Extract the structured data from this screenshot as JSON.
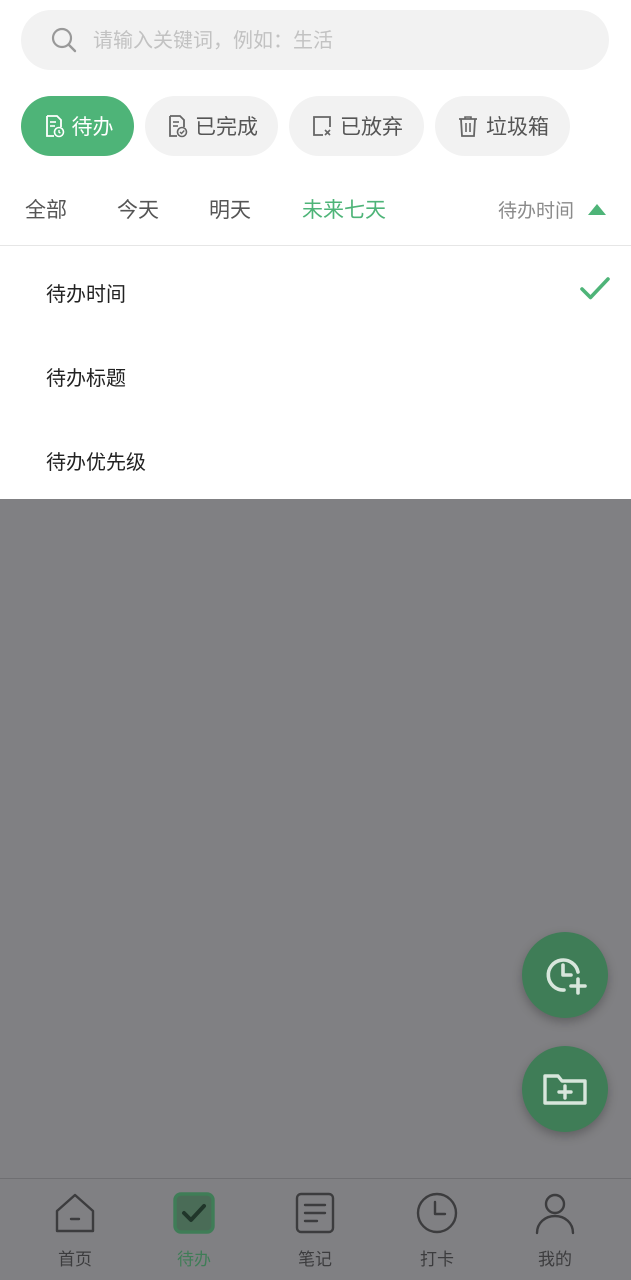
{
  "search": {
    "placeholder": "请输入关键词，例如：生活"
  },
  "categories": [
    {
      "label": "待办",
      "icon": "todo-doc-icon",
      "active": true
    },
    {
      "label": "已完成",
      "icon": "completed-doc-icon",
      "active": false
    },
    {
      "label": "已放弃",
      "icon": "abandoned-doc-icon",
      "active": false
    },
    {
      "label": "垃圾箱",
      "icon": "trash-icon",
      "active": false
    }
  ],
  "filters": [
    {
      "label": "全部",
      "active": false
    },
    {
      "label": "今天",
      "active": false
    },
    {
      "label": "明天",
      "active": false
    },
    {
      "label": "未来七天",
      "active": true
    }
  ],
  "sort": {
    "label": "待办时间",
    "icon": "triangle-up-icon"
  },
  "sort_menu": {
    "items": [
      {
        "label": "待办时间",
        "selected": true
      },
      {
        "label": "待办标题",
        "selected": false
      },
      {
        "label": "待办优先级",
        "selected": false
      }
    ],
    "selected_icon": "checkmark-icon"
  },
  "fabs": [
    {
      "icon": "clock-plus-icon"
    },
    {
      "icon": "folder-plus-icon"
    }
  ],
  "bottom_nav": [
    {
      "label": "首页",
      "icon": "home-icon",
      "active": false
    },
    {
      "label": "待办",
      "icon": "checkbox-icon",
      "active": true
    },
    {
      "label": "笔记",
      "icon": "note-icon",
      "active": false
    },
    {
      "label": "打卡",
      "icon": "clock-icon",
      "active": false
    },
    {
      "label": "我的",
      "icon": "person-icon",
      "active": false
    }
  ],
  "colors": {
    "accent": "#4eb478",
    "accent_dark": "#3f7d57",
    "overlay": "#808083",
    "chip_bg": "#f2f2f2"
  }
}
